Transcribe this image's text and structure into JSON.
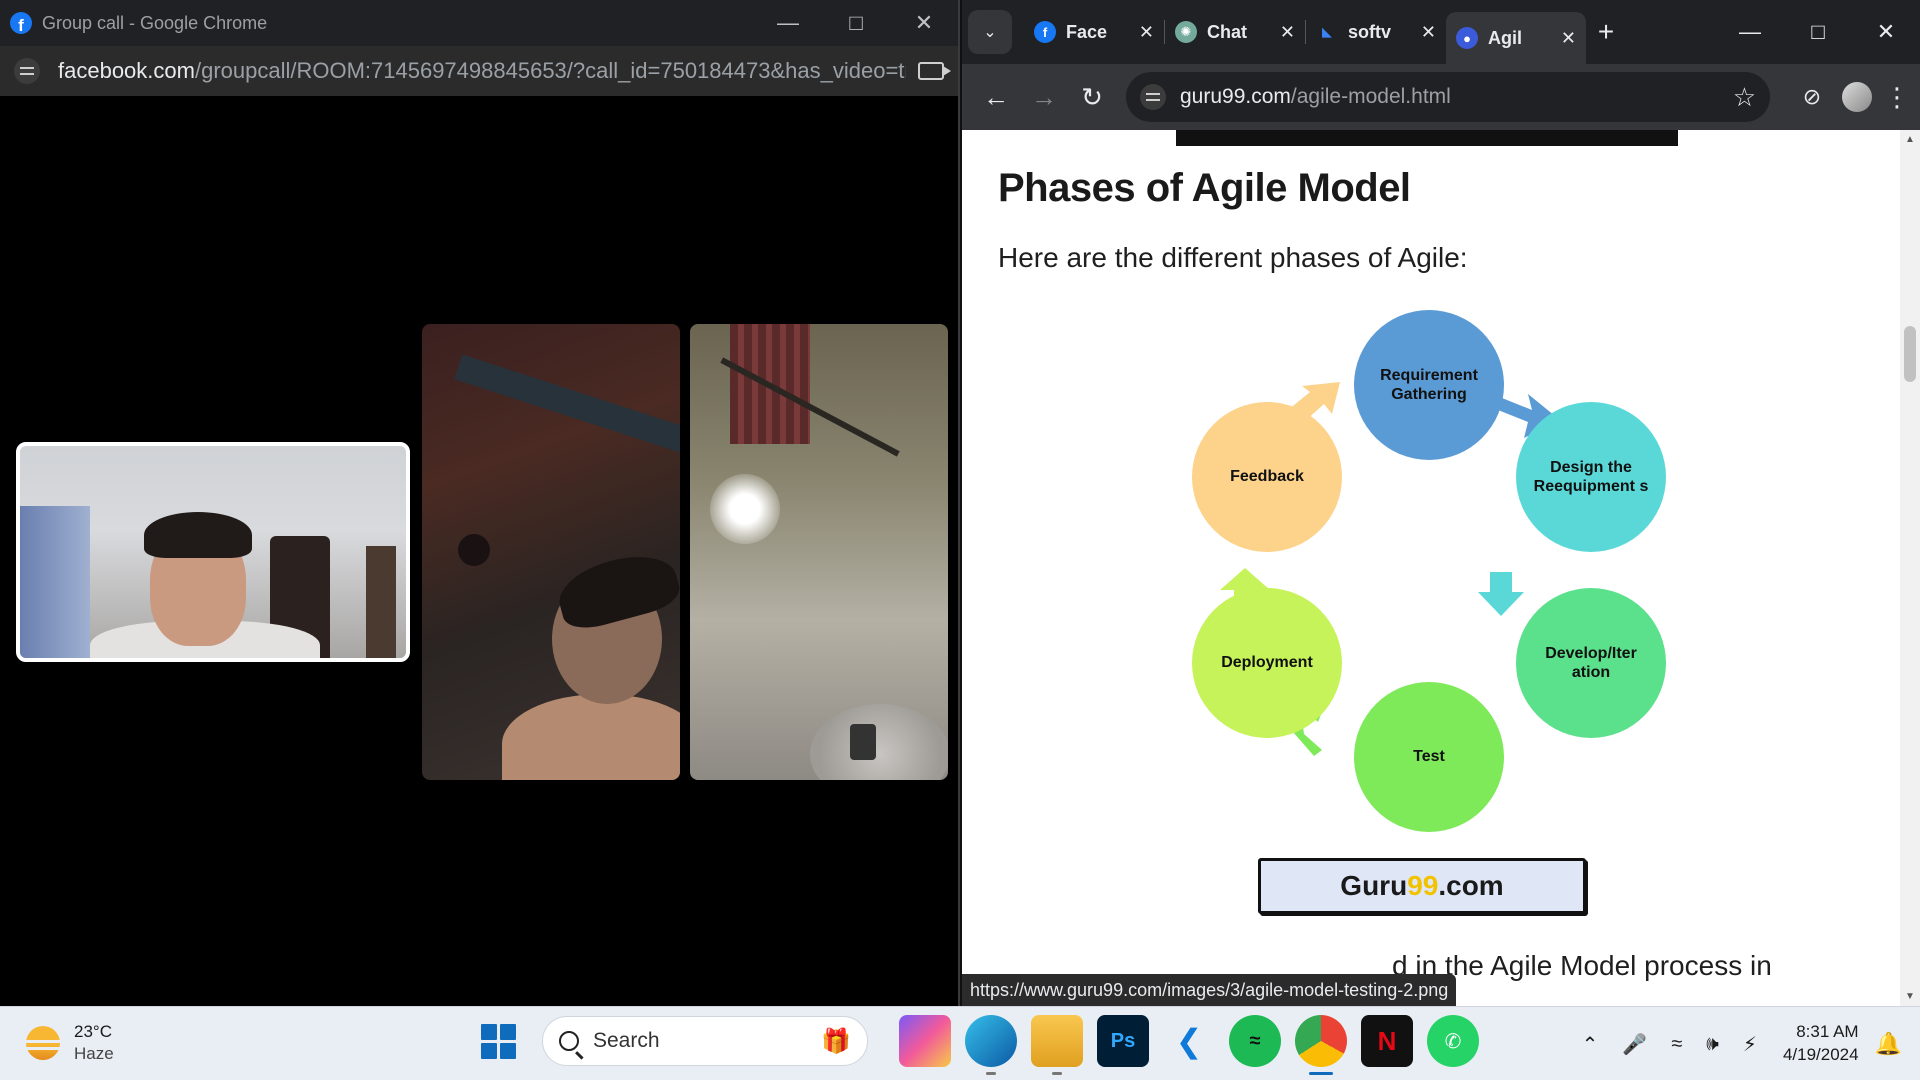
{
  "left_window": {
    "title": "Group call - Google Chrome",
    "url_host": "facebook.com",
    "url_path": "/groupcall/ROOM:7145697498845653/?call_id=750184473&has_video=tr..."
  },
  "right_window": {
    "tabs": [
      {
        "label": "Face",
        "icon": "facebook-icon",
        "color": "#1877f2"
      },
      {
        "label": "Chat",
        "icon": "chatgpt-icon",
        "color": "#74aa9c"
      },
      {
        "label": "softv",
        "icon": "tab-icon",
        "color": "#3b82f6"
      },
      {
        "label": "Agil",
        "icon": "guru99-icon",
        "color": "#3b5bdb"
      }
    ],
    "url_host": "guru99.com",
    "url_path": "/agile-model.html"
  },
  "page": {
    "heading": "Phases of Agile Model",
    "intro": "Here are the different phases of Agile:",
    "diagram": {
      "phases": [
        {
          "label": "Requirement Gathering",
          "color": "#5b9bd5"
        },
        {
          "label": "Design the Reequipment s",
          "color": "#5ad8d8"
        },
        {
          "label": "Develop/Iter ation",
          "color": "#5be08c"
        },
        {
          "label": "Test",
          "color": "#7eea5a"
        },
        {
          "label": "Deployment",
          "color": "#c6f25a"
        },
        {
          "label": "Feedback",
          "color": "#fdd28a"
        }
      ]
    },
    "logo_prefix": "Guru",
    "logo_nine": "99",
    "logo_suffix": ".com",
    "bottom_text": "d in the Agile Model process in",
    "status_url": "https://www.guru99.com/images/3/agile-model-testing-2.png"
  },
  "taskbar": {
    "temperature": "23°C",
    "condition": "Haze",
    "search_placeholder": "Search",
    "time": "8:31 AM",
    "date": "4/19/2024"
  }
}
